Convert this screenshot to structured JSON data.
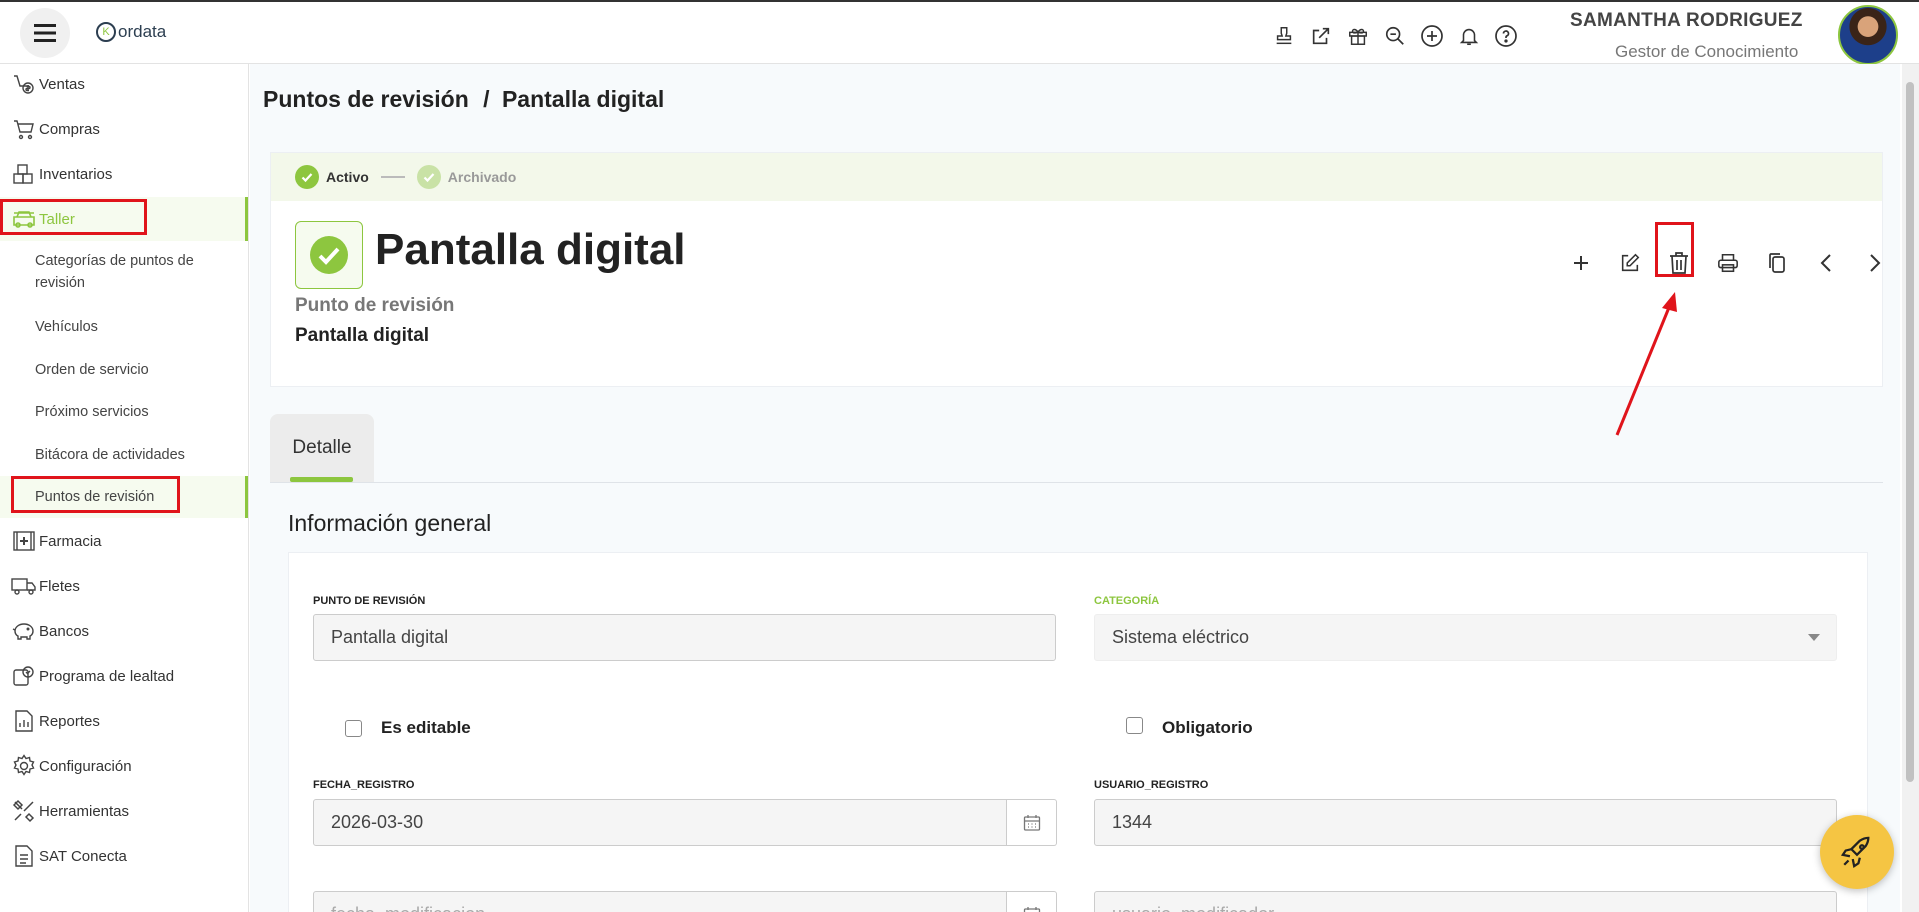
{
  "app": {
    "logo_text": "ordata",
    "logo_letter": "K"
  },
  "user": {
    "name": "SAMANTHA RODRIGUEZ",
    "role": "Gestor de Conocimiento"
  },
  "header_icons": [
    "stamp-icon",
    "external-link-icon",
    "gift-icon",
    "search-zoom-icon",
    "plus-circle-icon",
    "bell-icon",
    "help-icon"
  ],
  "sidebar": {
    "items": [
      {
        "label": "Ventas",
        "icon": "sales-icon"
      },
      {
        "label": "Compras",
        "icon": "cart-icon"
      },
      {
        "label": "Inventarios",
        "icon": "boxes-icon"
      },
      {
        "label": "Taller",
        "icon": "car-icon",
        "active": true
      },
      {
        "label": "Farmacia",
        "icon": "pharmacy-icon"
      },
      {
        "label": "Fletes",
        "icon": "truck-icon"
      },
      {
        "label": "Bancos",
        "icon": "piggy-bank-icon"
      },
      {
        "label": "Programa de lealtad",
        "icon": "loyalty-icon"
      },
      {
        "label": "Reportes",
        "icon": "report-icon"
      },
      {
        "label": "Configuración",
        "icon": "gear-icon"
      },
      {
        "label": "Herramientas",
        "icon": "tools-icon"
      },
      {
        "label": "SAT Conecta",
        "icon": "document-icon"
      }
    ],
    "taller_sub": [
      "Categorías de puntos de revisión",
      "Vehículos",
      "Orden de servicio",
      "Próximo servicios",
      "Bitácora de actividades",
      "Puntos de revisión"
    ]
  },
  "breadcrumb": {
    "parent": "Puntos de revisión",
    "separator": "/",
    "current": "Pantalla digital"
  },
  "status": {
    "step1": "Activo",
    "step2": "Archivado"
  },
  "record": {
    "title": "Pantalla digital",
    "type_label": "Punto de revisión",
    "name": "Pantalla digital"
  },
  "actions": [
    "add-icon",
    "edit-icon",
    "trash-icon",
    "print-icon",
    "copy-icon",
    "chevron-left-icon",
    "chevron-right-icon"
  ],
  "tabs": [
    {
      "label": "Detalle",
      "active": true
    }
  ],
  "section": {
    "title": "Información general"
  },
  "form": {
    "punto_label": "PUNTO DE REVISIÓN",
    "punto_value": "Pantalla digital",
    "categoria_label": "CATEGORÍA",
    "categoria_value": "Sistema eléctrico",
    "editable_label": "Es editable",
    "obligatorio_label": "Obligatorio",
    "fecha_registro_label": "FECHA_REGISTRO",
    "fecha_registro_value": "2026-03-30",
    "usuario_registro_label": "USUARIO_REGISTRO",
    "usuario_registro_value": "1344",
    "fecha_modificacion_placeholder": "fecha_modificacion",
    "usuario_modificador_placeholder": "usuario_modificador"
  },
  "colors": {
    "accent": "#8dc63f",
    "highlight": "#e0141b",
    "fab": "#f5c543"
  }
}
